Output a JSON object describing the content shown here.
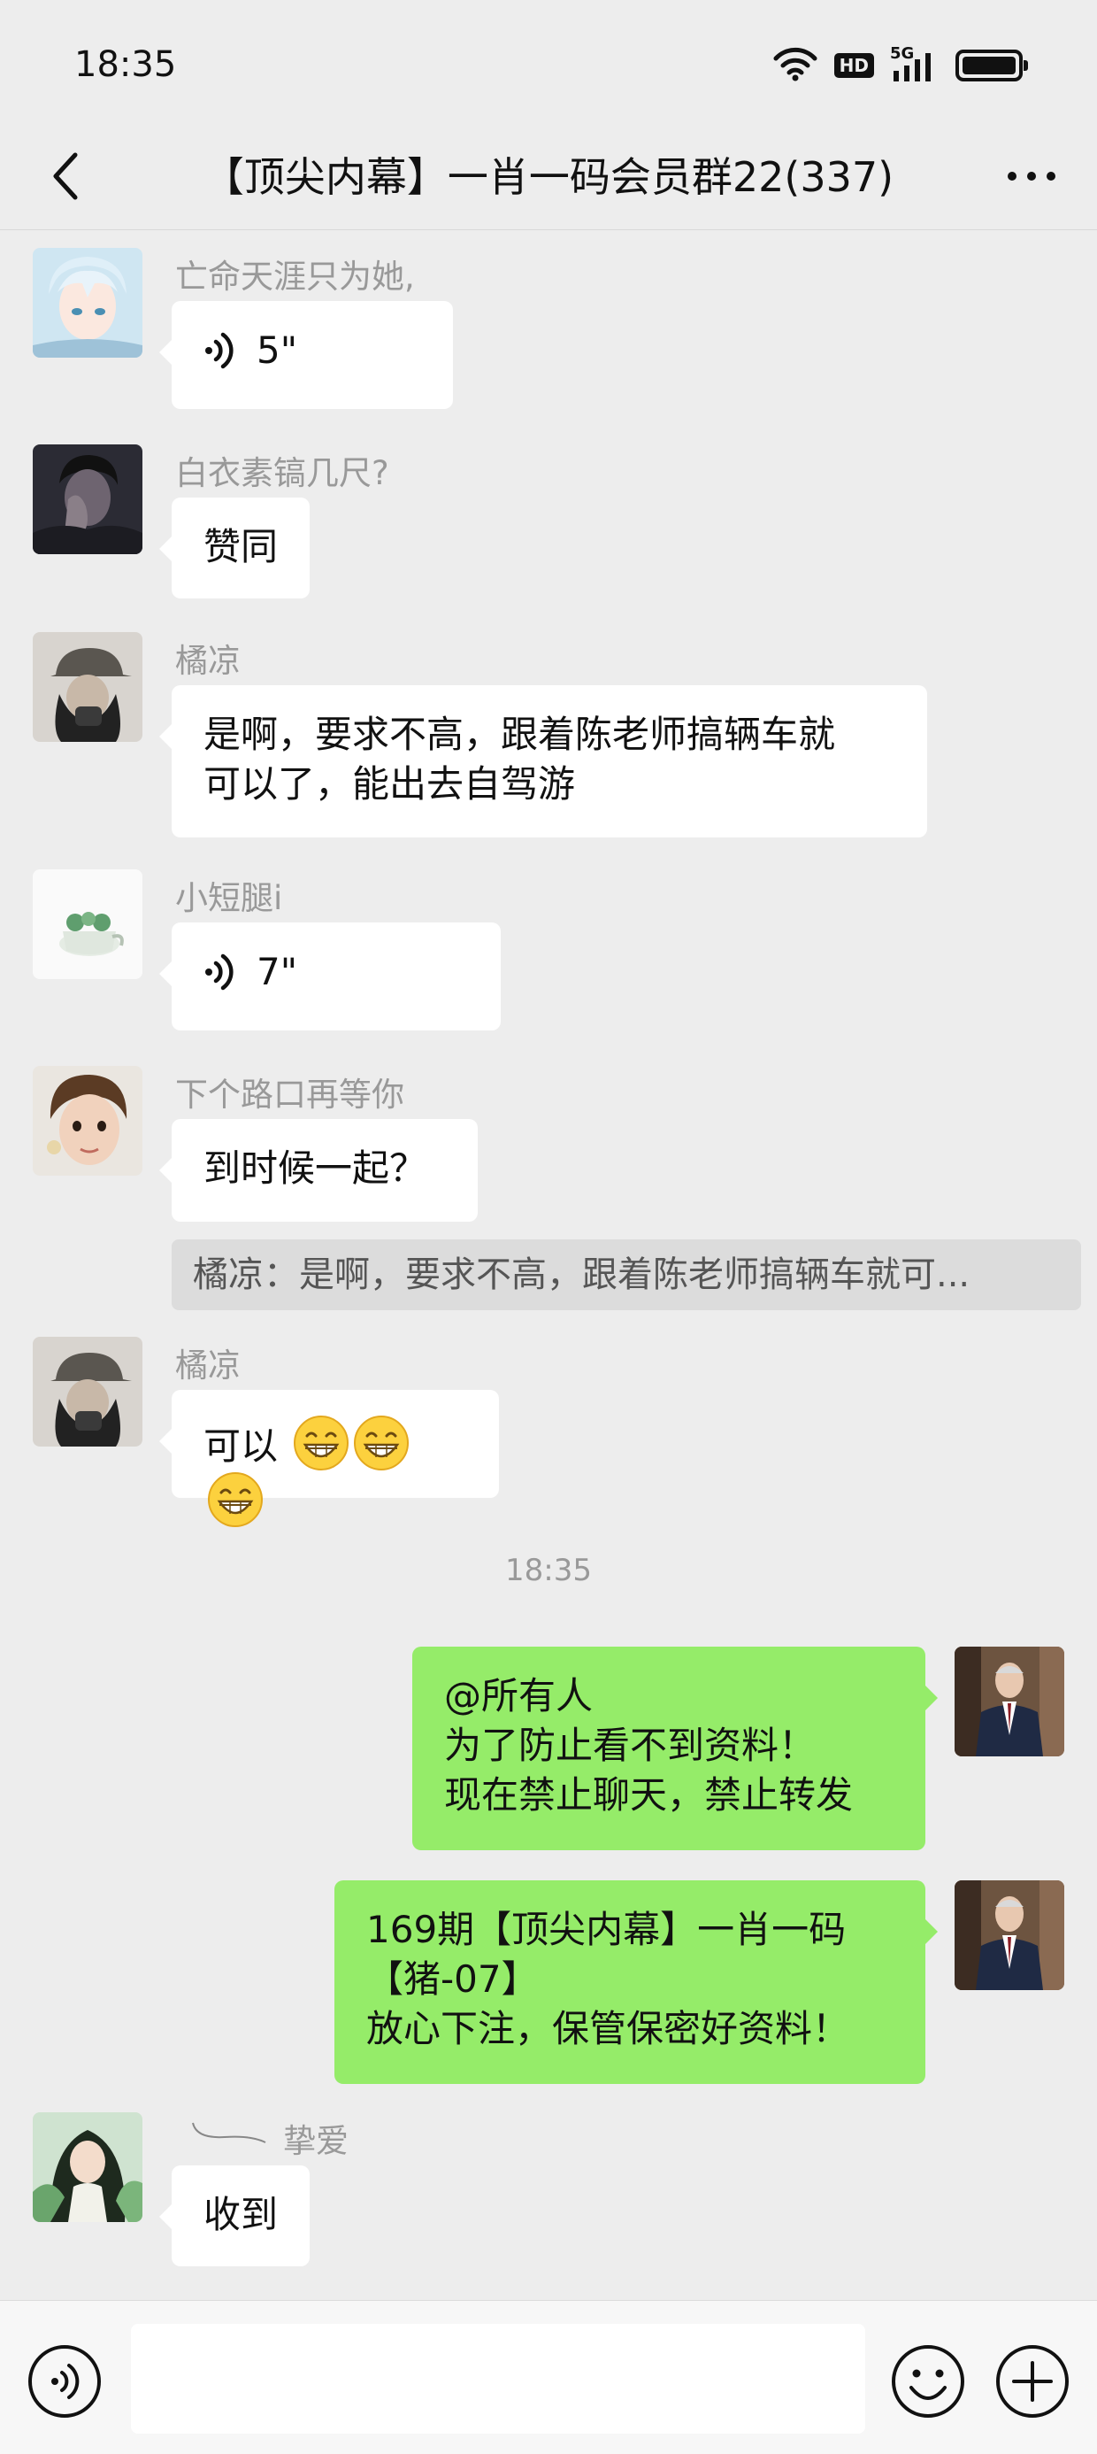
{
  "status_bar": {
    "time": "18:35",
    "hd": "HD",
    "network": "5G"
  },
  "header": {
    "title": "【顶尖内幕】一肖一码会员群22(337)"
  },
  "messages": [
    {
      "sender": "亡命天涯只为她,",
      "voice_duration": "5\""
    },
    {
      "sender": "白衣素镐几尺?",
      "text": "赞同"
    },
    {
      "sender": "橘凉",
      "line1": "是啊，要求不高，跟着陈老师搞辆车就",
      "line2": "可以了，能出去自驾游"
    },
    {
      "sender": "小短腿i",
      "voice_duration": "7\""
    },
    {
      "sender": "下个路口再等你",
      "text": "到时候一起？",
      "quote": "橘凉：是啊，要求不高，跟着陈老师搞辆车就可..."
    },
    {
      "sender": "橘凉",
      "text": "可以"
    },
    {
      "line1": "@所有人",
      "line2": "为了防止看不到资料！",
      "line3": "现在禁止聊天，禁止转发"
    },
    {
      "line1": "169期【顶尖内幕】一肖一码",
      "line2": "【猪-07】",
      "line3": "放心下注，保管保密好资料！"
    },
    {
      "sender": "挚爱",
      "text": "收到"
    }
  ],
  "timestamp": "18:35",
  "input": {
    "placeholder": ""
  },
  "colors": {
    "background": "#ededed",
    "bubble_in": "#ffffff",
    "bubble_out": "#95ec69",
    "sender_name": "#999999"
  }
}
